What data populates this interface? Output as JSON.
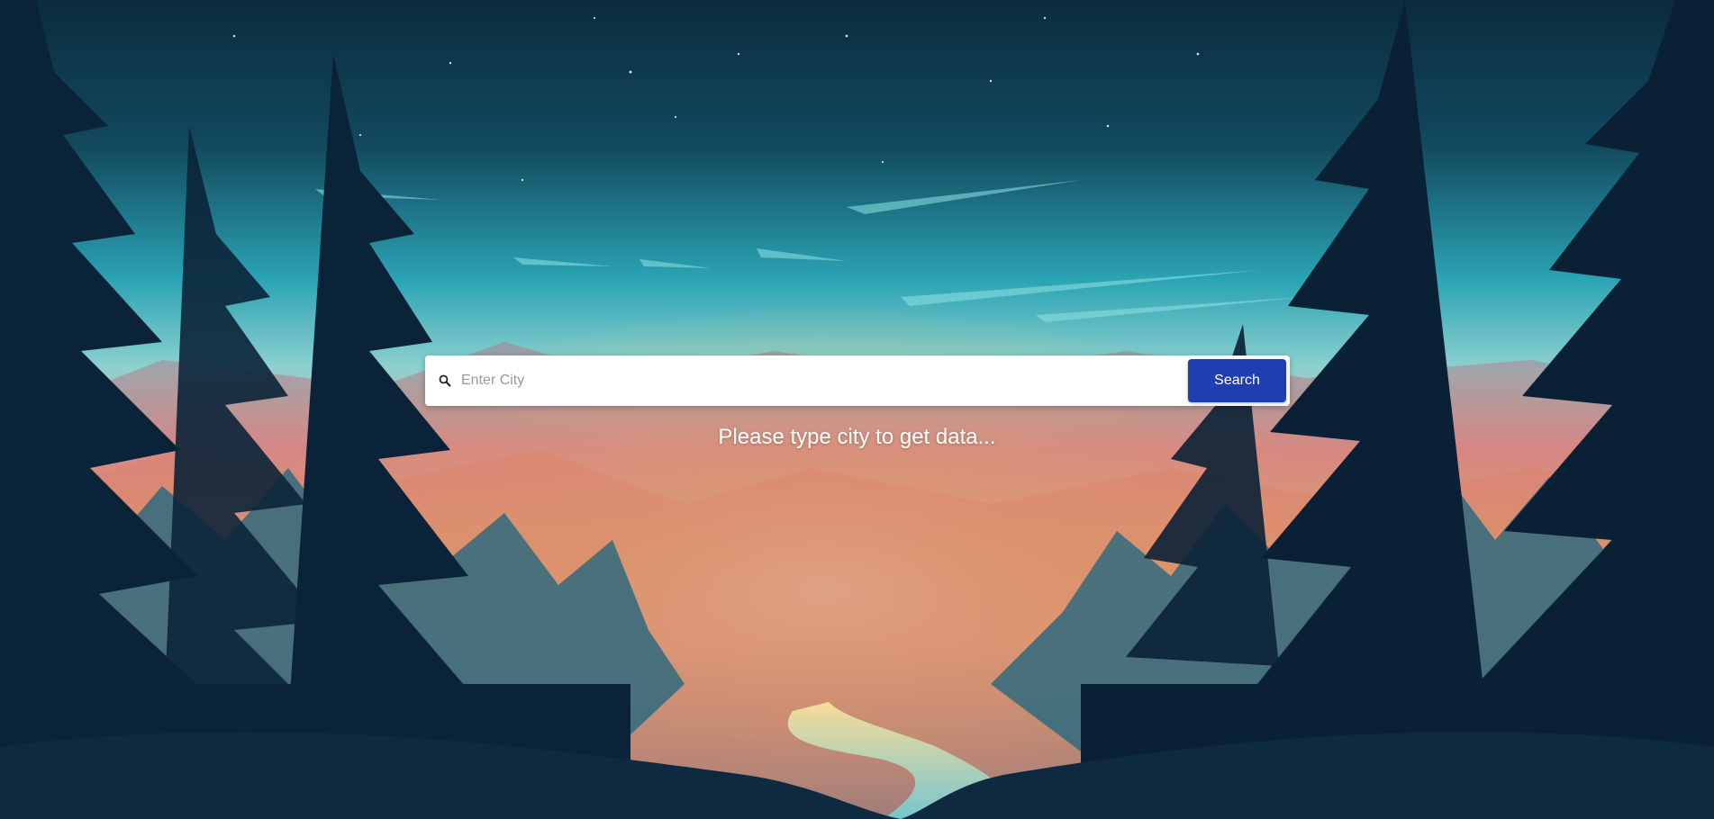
{
  "search": {
    "placeholder": "Enter City",
    "value": "",
    "icon": "search-icon",
    "button_label": "Search"
  },
  "status_message": "Please type city to get data...",
  "colors": {
    "button": "#1f3fb0",
    "sky_top": "#0b2a3e",
    "sky_mid": "#2aa3b3",
    "sunset": "#f6c35a",
    "forest_dark": "#081a2e"
  }
}
